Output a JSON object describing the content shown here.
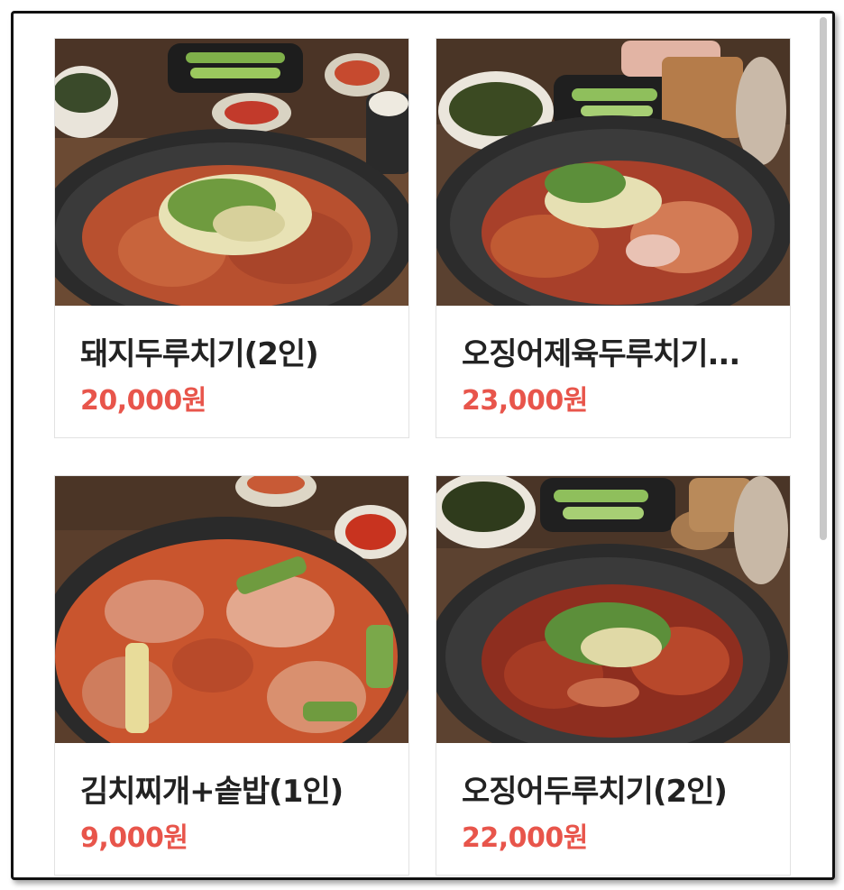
{
  "menu": {
    "items": [
      {
        "name": "돼지두루치기(2인)",
        "price": "20,000원",
        "image_icon": "pork-stir-fry-photo"
      },
      {
        "name": "오징어제육두루치기...",
        "price": "23,000원",
        "image_icon": "squid-pork-stir-fry-photo"
      },
      {
        "name": "김치찌개+솥밥(1인)",
        "price": "9,000원",
        "image_icon": "kimchi-stew-photo"
      },
      {
        "name": "오징어두루치기(2인)",
        "price": "22,000원",
        "image_icon": "squid-stir-fry-photo"
      }
    ]
  },
  "colors": {
    "price": "#e8554b",
    "name": "#222222",
    "border": "#e2e2e2"
  }
}
